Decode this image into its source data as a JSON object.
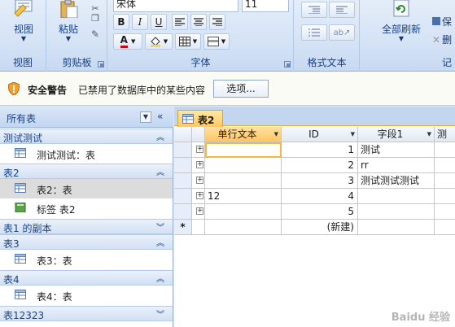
{
  "ribbon": {
    "groups": {
      "view": {
        "button_label": "视图",
        "group_label": "视图"
      },
      "clipboard": {
        "button_label": "粘贴",
        "group_label": "剪贴板"
      },
      "font": {
        "font_name": "宋体",
        "font_size": "11",
        "group_label": "字体",
        "bold": "B",
        "italic": "I",
        "underline": "U",
        "font_color_glyph": "A"
      },
      "rich_text": {
        "group_label": "格式文本"
      },
      "records": {
        "refresh_label": "全部刷新",
        "save_label": "保",
        "delete_label": "删",
        "group_label": "记"
      }
    }
  },
  "security_bar": {
    "title": "安全警告",
    "message": "已禁用了数据库中的某些内容",
    "options_button": "选项..."
  },
  "nav_pane": {
    "header": "所有表",
    "groups": [
      {
        "label": "测试测试",
        "items": [
          {
            "label": "测试测试：表"
          }
        ]
      },
      {
        "label": "表2",
        "items": [
          {
            "label": "表2：表",
            "selected": true
          },
          {
            "label": "标签 表2"
          }
        ]
      },
      {
        "label": "表1 的副本",
        "items": []
      },
      {
        "label": "表3",
        "items": [
          {
            "label": "表3：表"
          }
        ]
      },
      {
        "label": "表4",
        "items": [
          {
            "label": "表4：表"
          }
        ]
      },
      {
        "label": "表12323",
        "items": []
      }
    ]
  },
  "document": {
    "tab_label": "表2",
    "columns": [
      {
        "label": "单行文本"
      },
      {
        "label": "ID"
      },
      {
        "label": "字段1"
      },
      {
        "label": "测"
      }
    ],
    "rows": [
      {
        "text": "",
        "id": "1",
        "field1": "测试"
      },
      {
        "text": "",
        "id": "2",
        "field1": "rr"
      },
      {
        "text": "",
        "id": "3",
        "field1": "测试测试测试"
      },
      {
        "text": "12",
        "id": "4",
        "field1": ""
      },
      {
        "text": "",
        "id": "5",
        "field1": ""
      }
    ],
    "new_row_marker": "*",
    "new_row_label": "(新建)",
    "expander_glyph": "+"
  },
  "watermark": "Baidu 经验",
  "colors": {
    "accent": "#15428b",
    "active_tab": "#ffc95e",
    "grid_line": "#c7c7c7"
  }
}
